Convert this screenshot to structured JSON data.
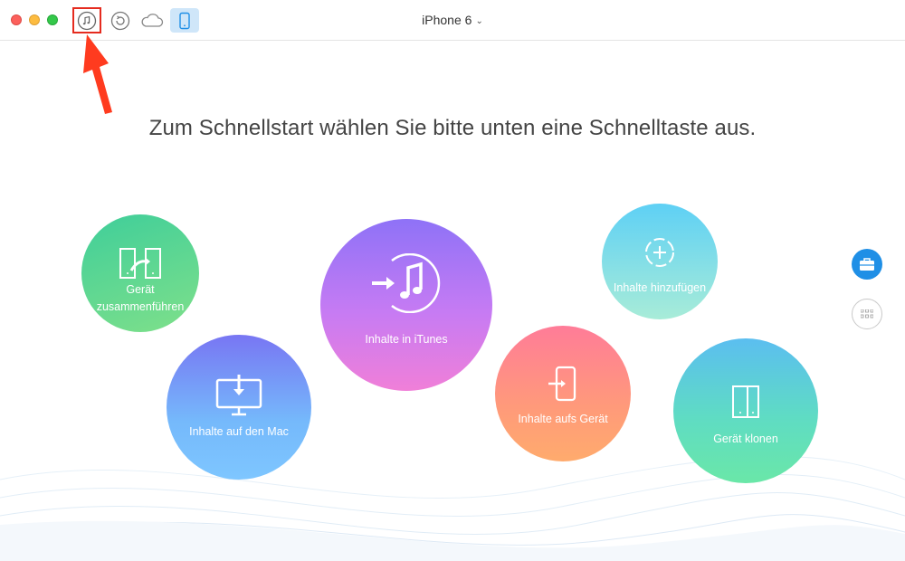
{
  "window": {
    "device_name": "iPhone 6",
    "toolbar_icons": [
      "itunes-library-icon",
      "backup-restore-icon",
      "icloud-icon",
      "device-icon"
    ]
  },
  "main": {
    "headline": "Zum Schnellstart wählen Sie bitte unten eine Schnelltaste aus."
  },
  "quick_actions": {
    "merge": {
      "label_line1": "Gerät",
      "label_line2": "zusammenführen",
      "icon": "merge-devices-icon"
    },
    "itunes": {
      "label": "Inhalte in iTunes",
      "icon": "music-to-itunes-icon"
    },
    "add": {
      "label": "Inhalte hinzufügen",
      "icon": "add-content-icon"
    },
    "mac": {
      "label": "Inhalte auf den Mac",
      "icon": "download-to-mac-icon"
    },
    "to_device": {
      "label": "Inhalte aufs Gerät",
      "icon": "import-to-device-icon"
    },
    "clone": {
      "label": "Gerät klonen",
      "icon": "clone-device-icon"
    }
  },
  "side_buttons": [
    "toolbox-icon",
    "grid-apps-icon"
  ],
  "colors": {
    "annotation_red": "#e52b1f",
    "accent_blue": "#1f8fe6",
    "device_tab_bg": "#cfe6f9"
  }
}
